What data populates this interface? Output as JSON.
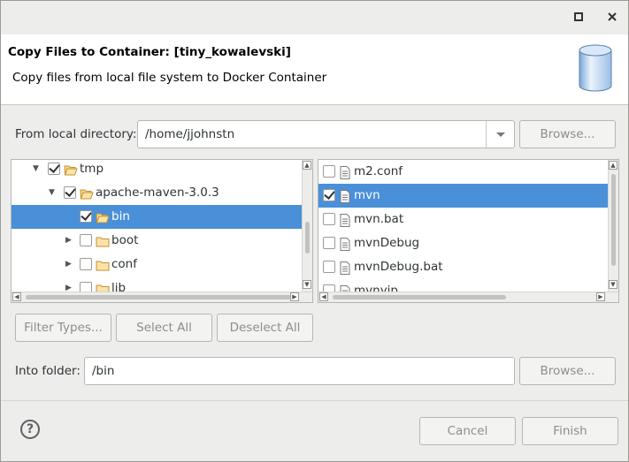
{
  "window": {
    "maximize_icon": "□",
    "close_icon": "✕"
  },
  "header": {
    "title": "Copy Files to Container: [tiny_kowalevski]",
    "description": "Copy files from local file system to Docker Container"
  },
  "source": {
    "label": "From local directory:",
    "value": "/home/jjohnstn",
    "browse_label": "Browse..."
  },
  "tree": [
    {
      "label": "tmp",
      "checked": true,
      "expanded": true,
      "level": 1,
      "icon": "folder-open-icon"
    },
    {
      "label": "apache-maven-3.0.3",
      "checked": true,
      "expanded": true,
      "level": 2,
      "icon": "folder-open-icon"
    },
    {
      "label": "bin",
      "checked": true,
      "expanded": false,
      "level": 3,
      "selected": true,
      "icon": "folder-open-icon"
    },
    {
      "label": "boot",
      "checked": false,
      "expanded": false,
      "level": 3,
      "icon": "folder-icon"
    },
    {
      "label": "conf",
      "checked": false,
      "expanded": false,
      "level": 3,
      "icon": "folder-icon"
    },
    {
      "label": "lib",
      "checked": false,
      "expanded": false,
      "level": 3,
      "icon": "folder-icon"
    }
  ],
  "files": [
    {
      "label": "m2.conf",
      "checked": false
    },
    {
      "label": "mvn",
      "checked": true,
      "selected": true
    },
    {
      "label": "mvn.bat",
      "checked": false
    },
    {
      "label": "mvnDebug",
      "checked": false
    },
    {
      "label": "mvnDebug.bat",
      "checked": false
    },
    {
      "label": "mvnyjp",
      "checked": false
    }
  ],
  "actions": {
    "filter_types": "Filter Types...",
    "select_all": "Select All",
    "deselect_all": "Deselect All"
  },
  "target": {
    "label": "Into folder:",
    "value": "/bin",
    "browse_label": "Browse..."
  },
  "footer": {
    "help_icon": "?",
    "cancel": "Cancel",
    "finish": "Finish"
  }
}
